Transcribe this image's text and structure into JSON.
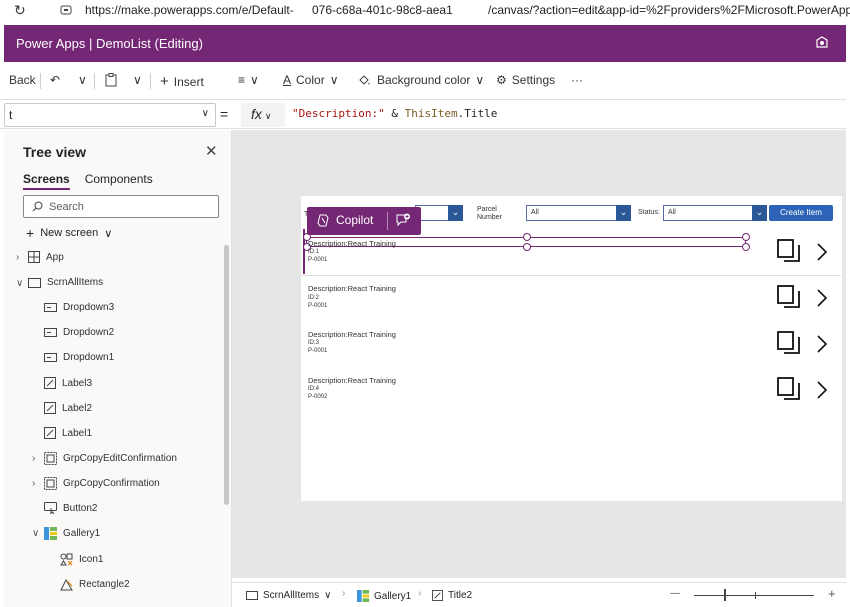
{
  "browser": {
    "url_part1": "https://make.powerapps.com/e/Default-",
    "url_part2": "076-c68a-401c-98c8-aea1",
    "url_part3": "/canvas/?action=edit&app-id=%2Fproviders%2FMicrosoft.PowerApps%2"
  },
  "header": {
    "title": "Power Apps  |  DemoList (Editing)"
  },
  "toolbar": {
    "back": "Back",
    "insert": "Insert",
    "color": "Color",
    "background_color": "Background color",
    "settings": "Settings",
    "more": "···"
  },
  "formula": {
    "property": "t",
    "eq": "=",
    "fx": "fx",
    "expr_string": "\"Description:\"",
    "expr_op": " & ",
    "expr_ref": "ThisItem",
    "expr_prop": ".Title"
  },
  "tree": {
    "title": "Tree view",
    "tabs": [
      "Screens",
      "Components"
    ],
    "search_placeholder": "Search",
    "new_screen": "New screen",
    "nodes": {
      "app": "App",
      "screen": "ScrnAllItems",
      "dropdown3": "Dropdown3",
      "dropdown2": "Dropdown2",
      "dropdown1": "Dropdown1",
      "label3": "Label3",
      "label2": "Label2",
      "label1": "Label1",
      "grpedit": "GrpCopyEditConfirmation",
      "grpcopy": "GrpCopyConfirmation",
      "button2": "Button2",
      "gallery1": "Gallery1",
      "icon1": "Icon1",
      "rectangle2": "Rectangle2"
    }
  },
  "app_screen": {
    "filter_t": "T",
    "parcel_label_1": "Parcel",
    "parcel_label_2": "Number",
    "parcel_value": "All",
    "status_label": "Status:",
    "status_value": "All",
    "create_button": "Create Item",
    "copilot_label": "Copilot",
    "rows": [
      {
        "desc": "Description:React Training",
        "id": "ID:1",
        "code": "P-0001"
      },
      {
        "desc": "Description:React Training",
        "id": "ID:2",
        "code": "P-0001"
      },
      {
        "desc": "Description:React Training",
        "id": "ID:3",
        "code": "P-0001"
      },
      {
        "desc": "Description:React Training",
        "id": "ID:4",
        "code": "P-0002"
      }
    ]
  },
  "statusbar": {
    "screen": "ScrnAllItems",
    "gallery": "Gallery1",
    "control": "Title2",
    "zoom_minus": "—",
    "zoom_plus": "+"
  },
  "colors": {
    "brand": "#742774",
    "accent": "#2e64b8"
  }
}
